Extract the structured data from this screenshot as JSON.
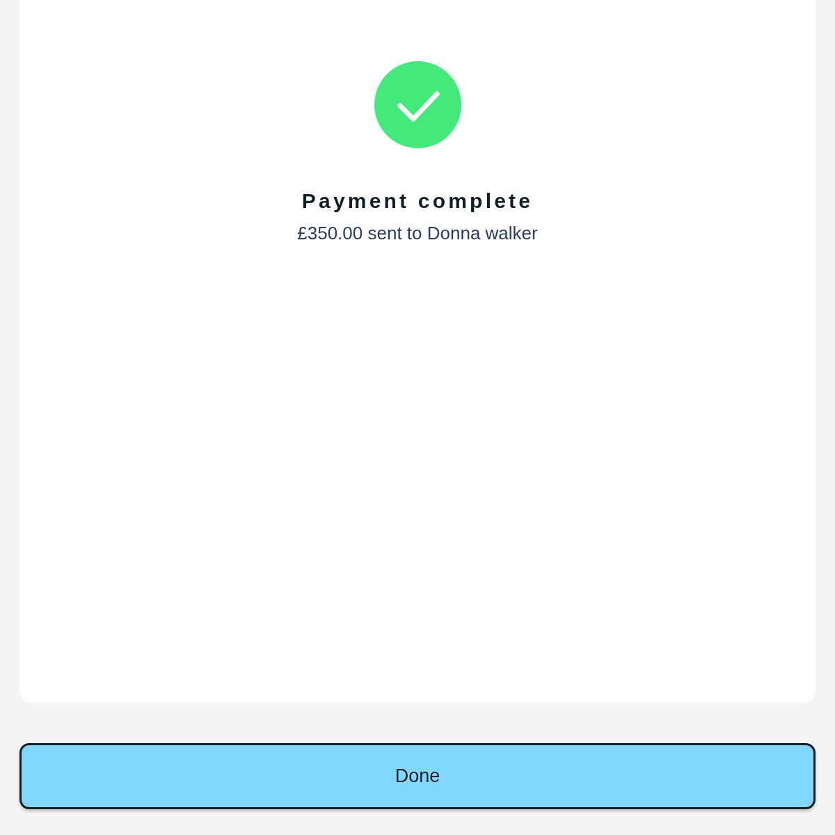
{
  "title": "Payment complete",
  "message": "£350.00 sent to Donna walker",
  "button": {
    "label": "Done"
  }
}
